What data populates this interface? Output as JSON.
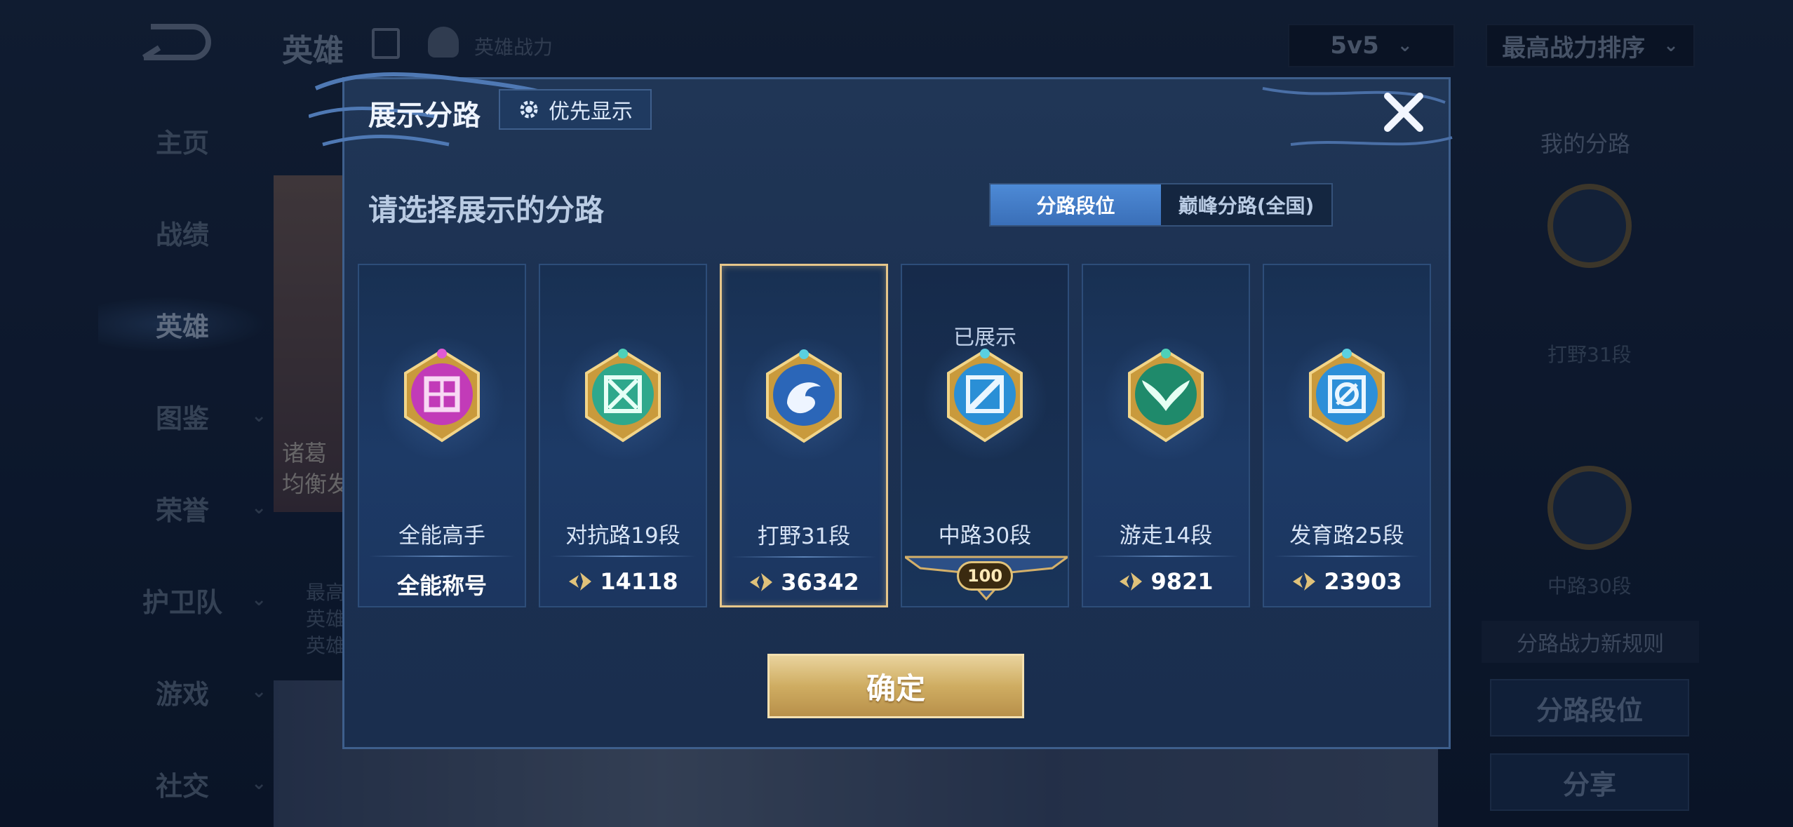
{
  "app": {
    "title": "英雄",
    "subtitle": "英雄战力",
    "mode_select": "5v5",
    "sort_select": "最高战力排序"
  },
  "sidebar": {
    "items": [
      {
        "label": "主页",
        "has_chevron": false
      },
      {
        "label": "战绩",
        "has_chevron": false
      },
      {
        "label": "英雄",
        "has_chevron": false,
        "active": true
      },
      {
        "label": "图鉴",
        "has_chevron": true
      },
      {
        "label": "荣誉",
        "has_chevron": true
      },
      {
        "label": "护卫队",
        "has_chevron": true
      },
      {
        "label": "游戏",
        "has_chevron": true
      },
      {
        "label": "社交",
        "has_chevron": true
      }
    ]
  },
  "hero_card": {
    "line1": "诸葛",
    "line2": "均衡发"
  },
  "hero_row_text": [
    "最高",
    "英雄",
    "英雄"
  ],
  "right_panel": {
    "title": "我的分路",
    "lane1": "打野31段",
    "lane2": "中路30段",
    "rule_link": "分路战力新规则",
    "btn_lane_rank": "分路段位",
    "btn_share": "分享"
  },
  "modal": {
    "title": "展示分路",
    "priority_button": "优先显示",
    "subtitle": "请选择展示的分路",
    "tabs": [
      {
        "label": "分路段位",
        "active": true
      },
      {
        "label": "巅峰分路(全国)",
        "active": false
      }
    ],
    "cards": [
      {
        "name": "全能高手",
        "value": "全能称号",
        "emblem": "versatile-emblem",
        "color": "#c23bb8",
        "power_icon": false
      },
      {
        "name": "对抗路19段",
        "value": "14118",
        "emblem": "clash-lane-emblem",
        "color": "#2fa88c",
        "power_icon": true
      },
      {
        "name": "打野31段",
        "value": "36342",
        "emblem": "jungle-emblem",
        "color": "#2b66b8",
        "power_icon": true,
        "selected": true
      },
      {
        "name": "中路30段",
        "value": "100",
        "emblem": "mid-lane-emblem",
        "color": "#2a8fd6",
        "shown_label": "已展示",
        "ribbon": true
      },
      {
        "name": "游走14段",
        "value": "9821",
        "emblem": "roam-emblem",
        "color": "#1f8a6b",
        "power_icon": true
      },
      {
        "name": "发育路25段",
        "value": "23903",
        "emblem": "farm-lane-emblem",
        "color": "#2d8fd8",
        "power_icon": true
      }
    ],
    "confirm": "确定"
  }
}
